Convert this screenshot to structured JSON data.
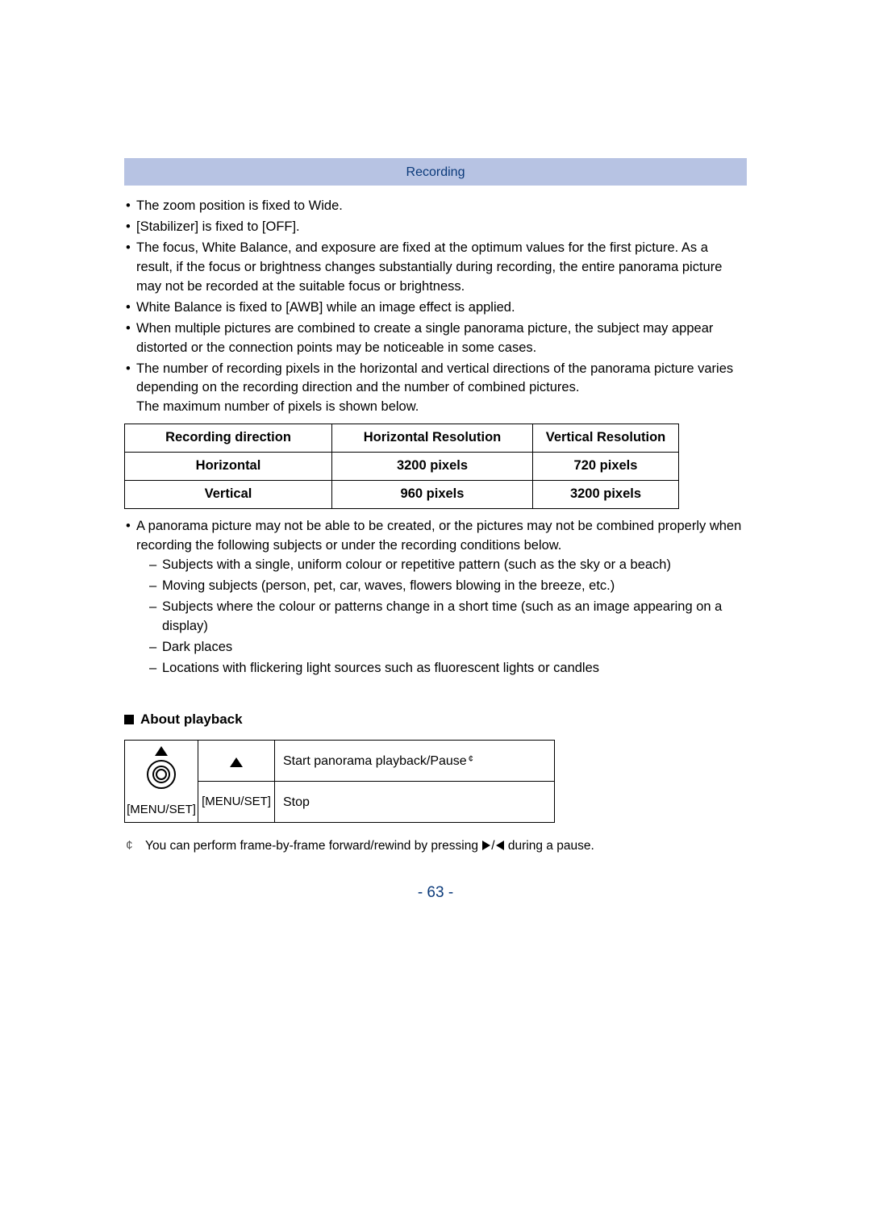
{
  "section_header": "Recording",
  "bullets_top": [
    "The zoom position is fixed to Wide.",
    "[Stabilizer] is fixed to [OFF].",
    "The focus, White Balance, and exposure are fixed at the optimum values for the first picture. As a result, if the focus or brightness changes substantially during recording, the entire panorama picture may not be recorded at the suitable focus or brightness.",
    "White Balance is fixed to [AWB] while an image effect is applied.",
    "When multiple pictures are combined to create a single panorama picture, the subject may appear distorted or the connection points may be noticeable in some cases.",
    "The number of recording pixels in the horizontal and vertical directions of the panorama picture varies depending on the recording direction and the number of combined pictures.\nThe maximum number of pixels is shown below."
  ],
  "res_table": {
    "headers": [
      "Recording direction",
      "Horizontal Resolution",
      "Vertical Resolution"
    ],
    "rows": [
      [
        "Horizontal",
        "3200 pixels",
        "720 pixels"
      ],
      [
        "Vertical",
        "960 pixels",
        "3200 pixels"
      ]
    ]
  },
  "bullets_bottom_lead": "A panorama picture may not be able to be created, or the pictures may not be combined properly when recording the following subjects or under the recording conditions below.",
  "dash_items": [
    "Subjects with a single, uniform colour or repetitive pattern (such as the sky or a beach)",
    "Moving subjects (person, pet, car, waves, flowers blowing in the breeze, etc.)",
    "Subjects where the colour or patterns change in a short time (such as an image appearing on a display)",
    "Dark places",
    "Locations with flickering light sources such as fluorescent lights or candles"
  ],
  "about_playback_heading": "About playback",
  "menuset_label": "[MENU/SET]",
  "playback_table": {
    "row_up_desc": "Start panorama playback/Pause",
    "row_menuset_button": "[MENU/SET]",
    "row_menuset_desc": "Stop"
  },
  "footnote_asterisk": "¢",
  "footnote_text_1": "You can perform frame-by-frame forward/rewind by pressing ",
  "footnote_text_2": " during a pause.",
  "page_number": "- 63 -"
}
